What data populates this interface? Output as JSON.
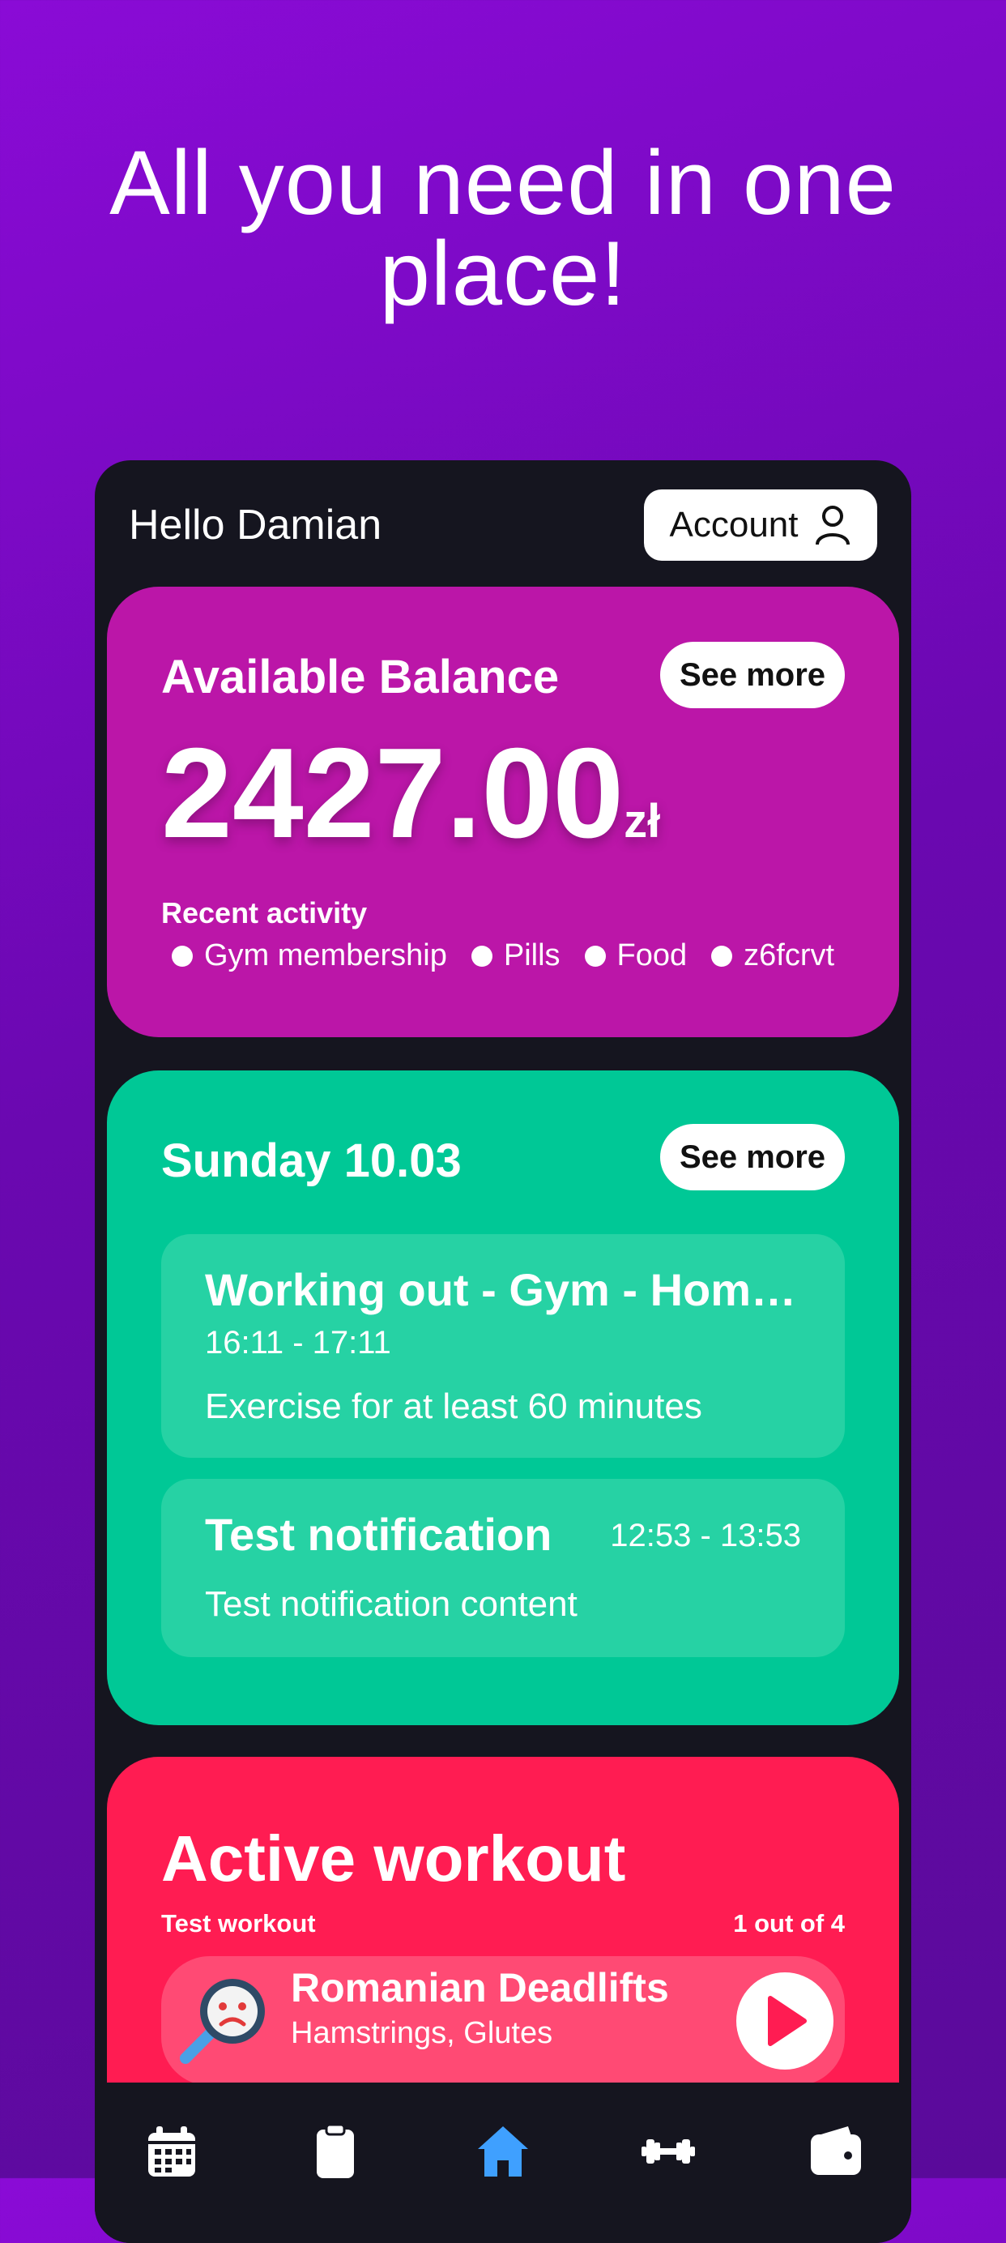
{
  "headline": "All you need in one place!",
  "header": {
    "greeting": "Hello Damian",
    "account_label": "Account"
  },
  "balance": {
    "title": "Available Balance",
    "see_more": "See more",
    "amount": "2427.00",
    "currency": "zł",
    "recent_title": "Recent activity",
    "recent": [
      "Gym membership",
      "Pills",
      "Food",
      "z6fcrvt"
    ]
  },
  "schedule": {
    "date": "Sunday 10.03",
    "see_more": "See more",
    "events": [
      {
        "title": "Working out - Gym - Hom…",
        "time": "16:11 - 17:11",
        "body": "Exercise for at least 60 minutes"
      },
      {
        "title": "Test notification",
        "time": "12:53 - 13:53",
        "body": "Test notification content"
      }
    ]
  },
  "workout": {
    "title": "Active workout",
    "name": "Test workout",
    "progress": "1 out of 4",
    "exercise_name": "Romanian Deadlifts",
    "muscles": "Hamstrings, Glutes"
  },
  "colors": {
    "balance_card": "#bb16a8",
    "schedule_card": "#00c896",
    "workout_card": "#ff1c52",
    "active_nav": "#3fa0ff"
  },
  "nav": [
    "calendar-icon",
    "clipboard-icon",
    "home-icon",
    "dumbbell-icon",
    "wallet-icon"
  ]
}
